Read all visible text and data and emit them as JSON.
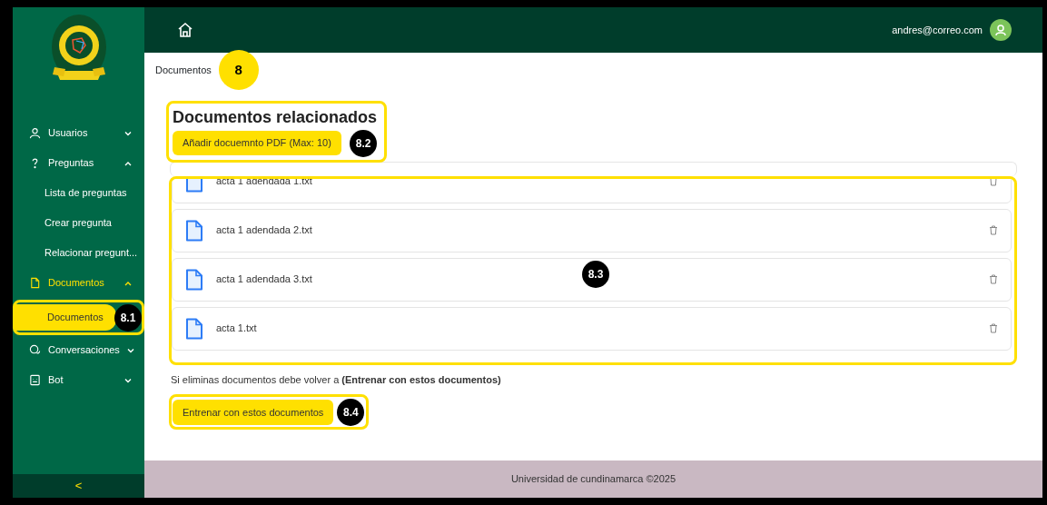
{
  "sidebar": {
    "items": [
      {
        "label": "Usuarios",
        "expanded": false,
        "selected": false
      },
      {
        "label": "Preguntas",
        "expanded": true,
        "selected": false,
        "children": [
          {
            "label": "Lista de preguntas",
            "selected": false
          },
          {
            "label": "Crear pregunta",
            "selected": false
          },
          {
            "label": "Relacionar pregunt...",
            "selected": false
          }
        ]
      },
      {
        "label": "Documentos",
        "expanded": true,
        "selected": true,
        "children": [
          {
            "label": "Documentos",
            "selected": true,
            "callout": {
              "label": "8.1",
              "kind": "dark"
            }
          }
        ]
      },
      {
        "label": "Conversaciones",
        "expanded": false,
        "selected": false
      },
      {
        "label": "Bot",
        "expanded": false,
        "selected": false
      }
    ],
    "collapse_button": "<"
  },
  "topbar": {
    "user_email": "andres@correo.com"
  },
  "breadcrumb": {
    "label": "Documentos",
    "callout": {
      "label": "8",
      "kind": "light"
    }
  },
  "documents": {
    "title": "Documentos relacionados",
    "add_button": "Añadir docuemnto PDF (Max: 10)",
    "callout": {
      "label": "8.2",
      "kind": "dark"
    },
    "files": [
      {
        "name": "acta 1 adendada 1.txt"
      },
      {
        "name": "acta 1 adendada 2.txt"
      },
      {
        "name": "acta 1 adendada 3.txt"
      },
      {
        "name": "acta 1.txt"
      }
    ],
    "files_callout": {
      "label": "8.3",
      "kind": "dark"
    },
    "note": "Si eliminas documentos debe volver a **(Entrenar con estos documentos)**",
    "train_button": "Entrenar con estos documentos",
    "train_callout": {
      "label": "8.4",
      "kind": "dark"
    }
  },
  "footer": "Universidad de cundinamarca ©2025"
}
